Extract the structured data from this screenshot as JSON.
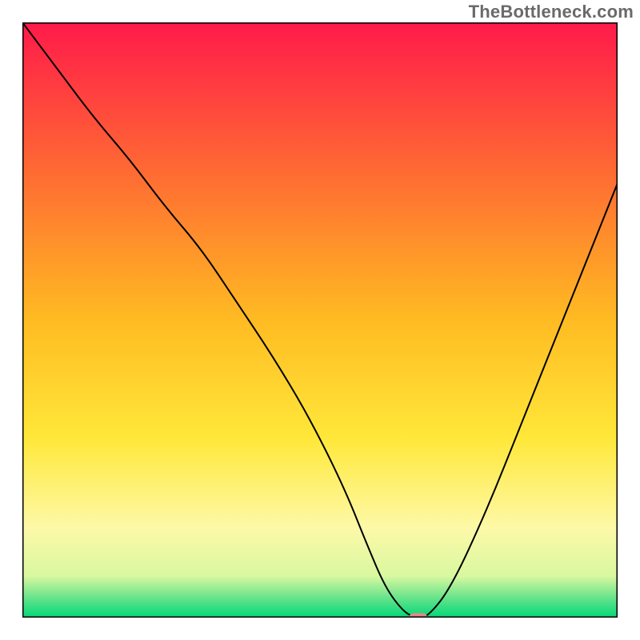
{
  "watermark": "TheBottleneck.com",
  "chart_data": {
    "type": "line",
    "title": "",
    "xlabel": "",
    "ylabel": "",
    "xlim": [
      0,
      100
    ],
    "ylim": [
      0,
      100
    ],
    "grid": false,
    "legend": false,
    "background_gradient": {
      "stops": [
        {
          "offset": 0,
          "color": "#ff1a4a"
        },
        {
          "offset": 25,
          "color": "#ff6a33"
        },
        {
          "offset": 50,
          "color": "#ffbb22"
        },
        {
          "offset": 70,
          "color": "#ffe83a"
        },
        {
          "offset": 85,
          "color": "#fdf9a8"
        },
        {
          "offset": 93,
          "color": "#d9f8a0"
        },
        {
          "offset": 97,
          "color": "#5de28a"
        },
        {
          "offset": 100,
          "color": "#00d878"
        }
      ]
    },
    "series": [
      {
        "name": "curve",
        "x": [
          0,
          6,
          12,
          18,
          24,
          30,
          36,
          42,
          48,
          54,
          58,
          61,
          64,
          66,
          68,
          72,
          78,
          84,
          90,
          96,
          100
        ],
        "values": [
          100,
          92,
          84,
          77,
          69,
          62,
          53,
          44,
          34,
          22,
          12,
          5,
          1,
          0,
          0,
          5,
          18,
          33,
          48,
          63,
          73
        ]
      }
    ],
    "marker": {
      "x": 66.5,
      "y": 0,
      "color": "#e08a8a",
      "width": 3,
      "height": 1.5
    },
    "frame_color": "#000000"
  }
}
